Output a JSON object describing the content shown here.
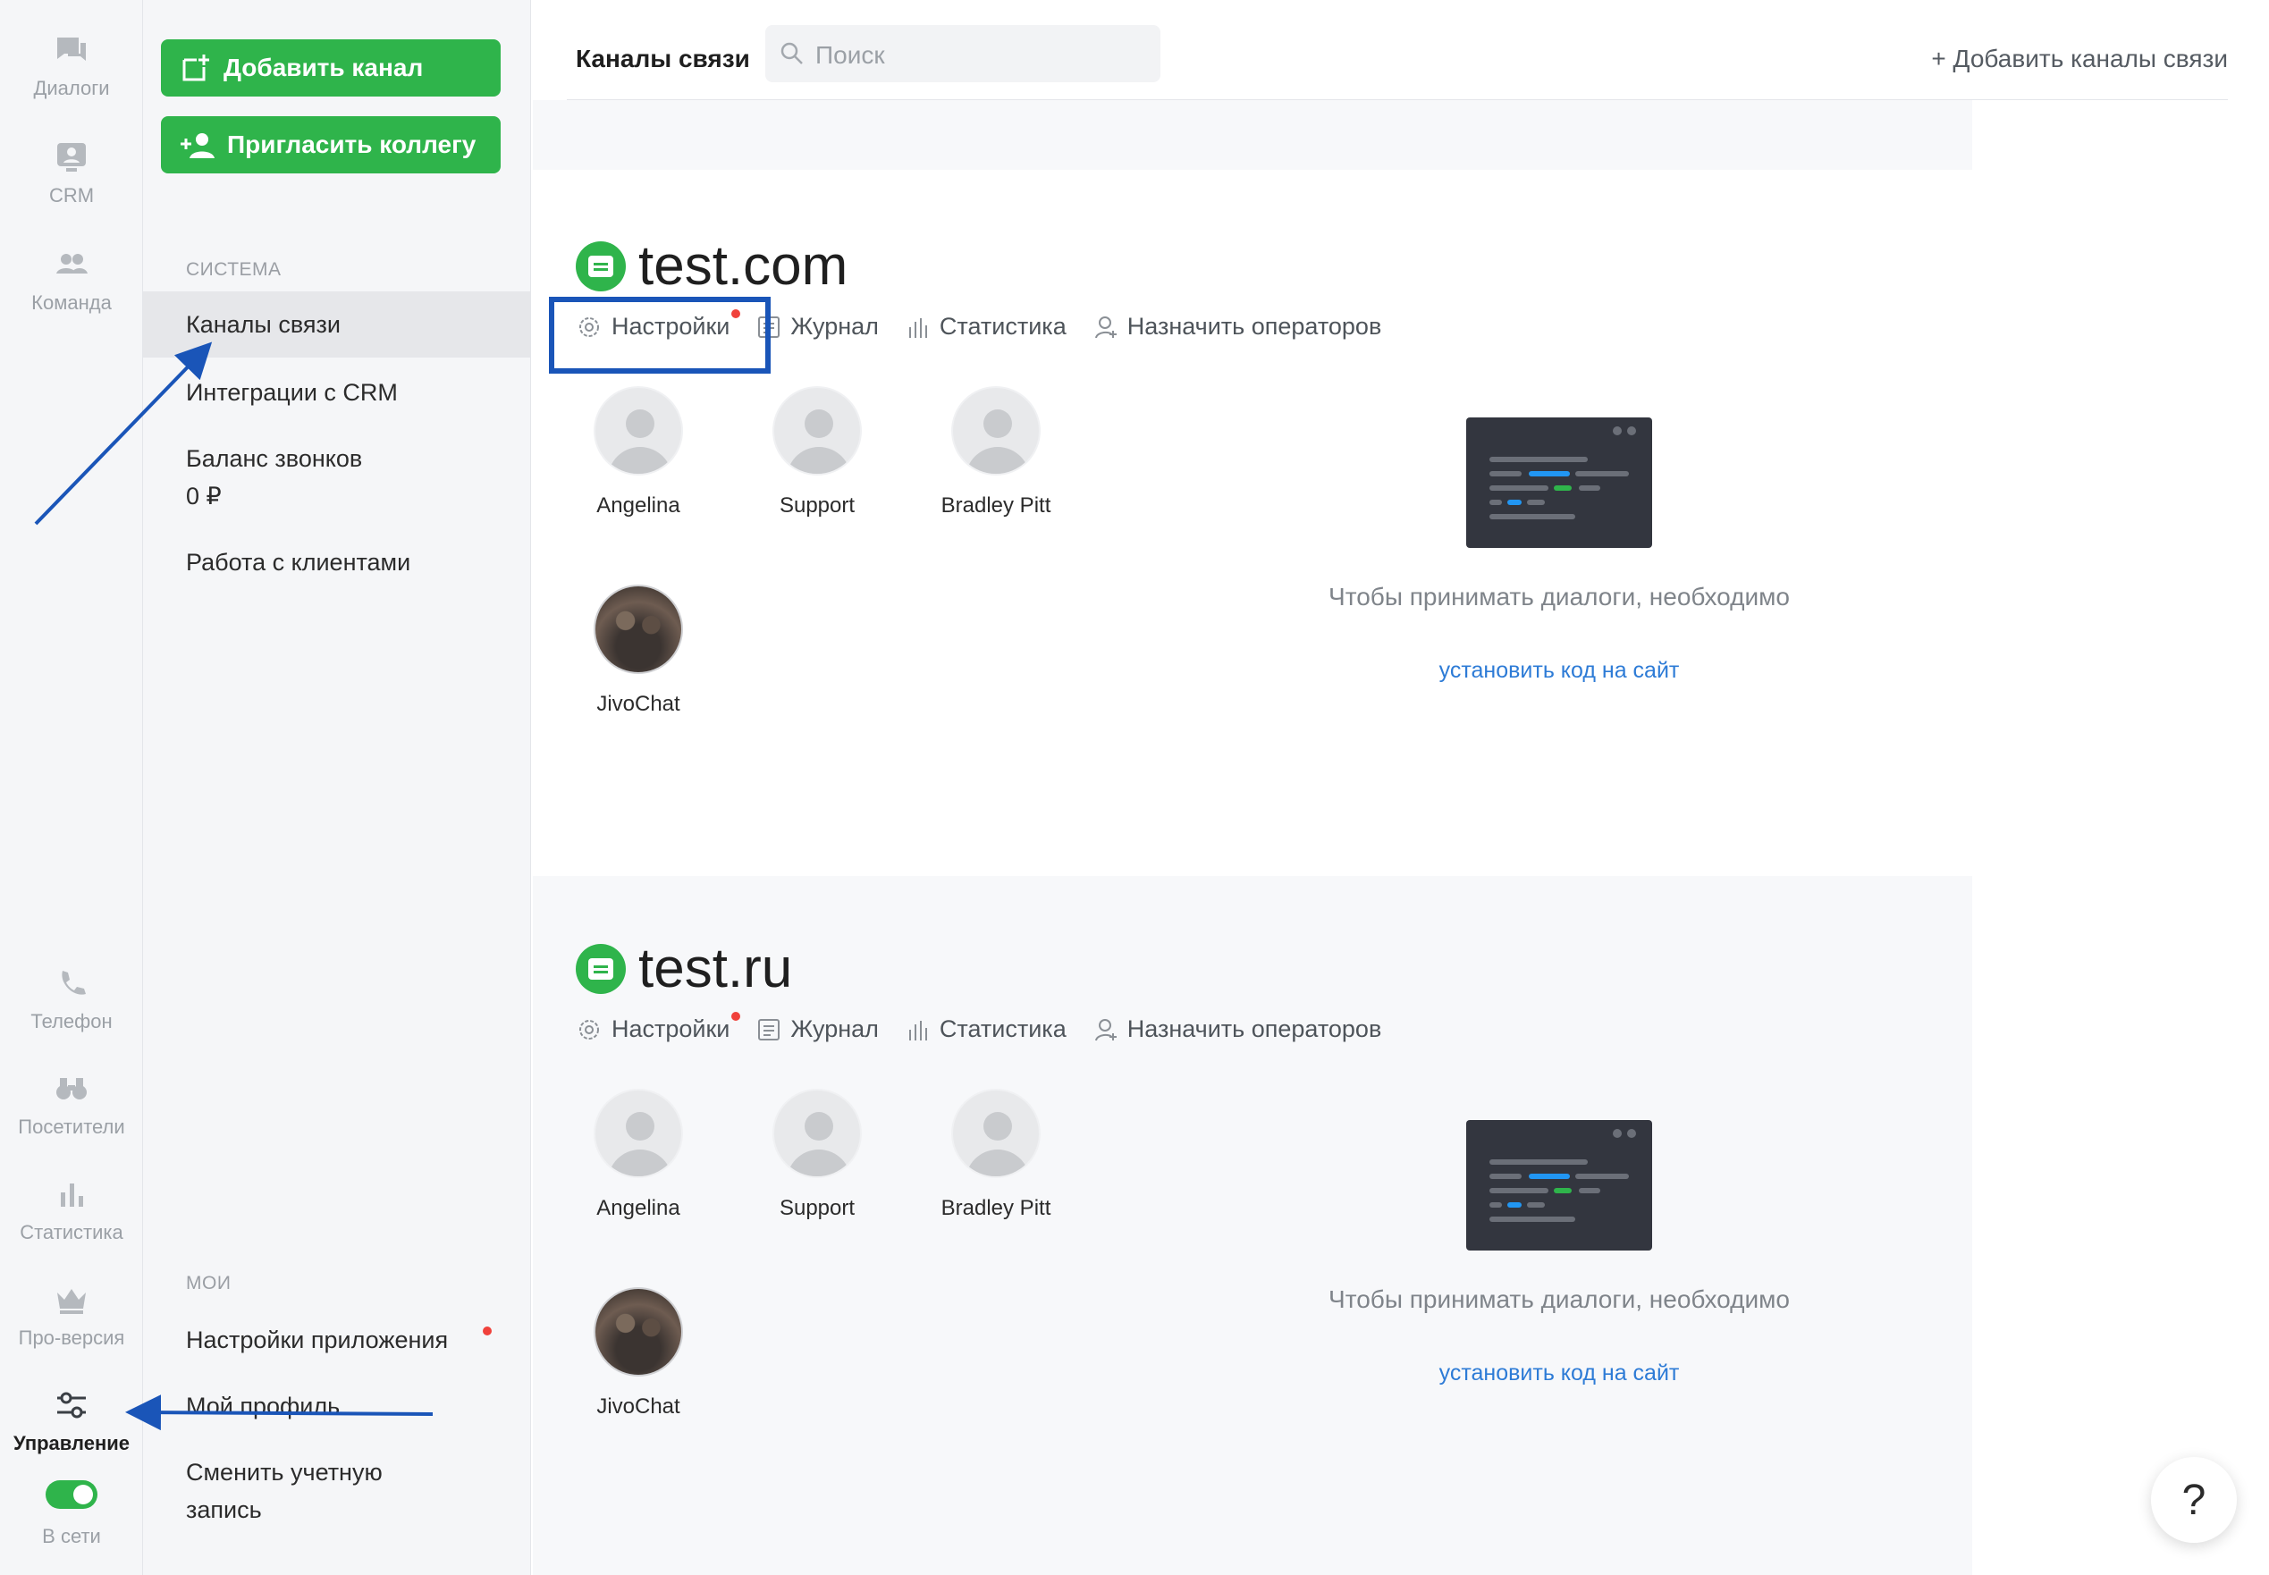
{
  "rail": {
    "items": [
      {
        "label": "Диалоги",
        "icon": "dialogs-icon"
      },
      {
        "label": "CRM",
        "icon": "crm-icon"
      },
      {
        "label": "Команда",
        "icon": "team-icon"
      },
      {
        "label": "Телефон",
        "icon": "phone-icon"
      },
      {
        "label": "Посетители",
        "icon": "binoculars-icon"
      },
      {
        "label": "Статистика",
        "icon": "stats-icon"
      },
      {
        "label": "Про-версия",
        "icon": "crown-icon"
      },
      {
        "label": "Управление",
        "icon": "sliders-icon",
        "active": true
      }
    ],
    "status": "В сети"
  },
  "sidebar": {
    "add_channel": "Добавить канал",
    "invite_colleague": "Пригласить коллегу",
    "section_system": "СИСТЕМА",
    "system_items": [
      "Каналы связи",
      "Интеграции с CRM",
      "Баланс звонков",
      "0 ₽",
      "Работа с клиентами"
    ],
    "section_my": "МОИ",
    "my_items": [
      "Настройки приложения",
      "Мой профиль",
      "Сменить учетную",
      "запись"
    ]
  },
  "topbar": {
    "title": "Каналы связи",
    "search_placeholder": "Поиск",
    "add_channels": "+ Добавить каналы связи"
  },
  "channels": [
    {
      "name": "test.com",
      "tabs": [
        "Настройки",
        "Журнал",
        "Статистика",
        "Назначить операторов"
      ],
      "operators": [
        "Angelina",
        "Support",
        "Bradley Pitt",
        "JivoChat"
      ],
      "hint": "Чтобы принимать диалоги, необходимо",
      "link": "установить код на сайт"
    },
    {
      "name": "test.ru",
      "tabs": [
        "Настройки",
        "Журнал",
        "Статистика",
        "Назначить операторов"
      ],
      "operators": [
        "Angelina",
        "Support",
        "Bradley Pitt",
        "JivoChat"
      ],
      "hint": "Чтобы принимать диалоги, необходимо",
      "link": "установить код на сайт"
    }
  ],
  "help": "?",
  "colors": {
    "accent": "#2fb44b",
    "highlight": "#1a55b8",
    "link": "#2d7bd6",
    "dot": "#f0413b"
  }
}
